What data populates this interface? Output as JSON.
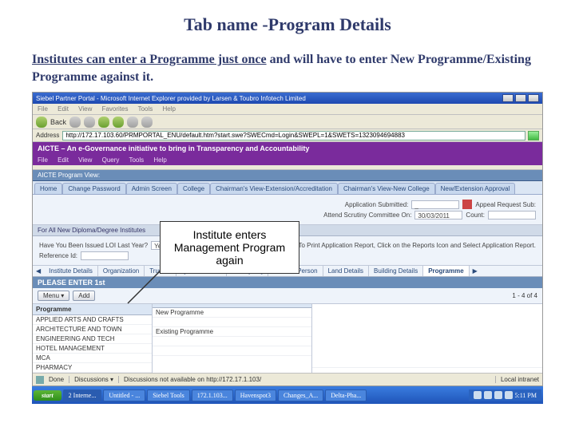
{
  "slide": {
    "title": "Tab name -Program Details",
    "sub_prefix_underlined": "Institutes can enter a Programme just once",
    "sub_suffix": " and will have to enter New Programme/Existing Programme against it."
  },
  "callout": "Institute enters Management Program again",
  "browser": {
    "title": "Siebel Partner Portal - Microsoft Internet Explorer provided by Larsen & Toubro Infotech Limited",
    "menu": [
      "File",
      "Edit",
      "View",
      "Favorites",
      "Tools",
      "Help"
    ],
    "back": "Back",
    "address_label": "Address",
    "url": "http://172.17.103.60/PRMPORTAL_ENU/default.htm?start.swe?SWECmd=Login&SWEPL=1&SWETS=1323094694883",
    "go": "Go"
  },
  "app": {
    "banner": "AICTE – An e-Governance initiative to bring in Transparency and Accountability",
    "menu": [
      "File",
      "Edit",
      "View",
      "Query",
      "Tools",
      "Help"
    ],
    "view_title": "AICTE Program View:",
    "tabs": [
      "Home",
      "Change Password",
      "Admin Screen",
      "College",
      "Chairman's View-Extension/Accreditation",
      "Chairman's View-New College",
      "New/Extension Approval"
    ]
  },
  "header_fields": {
    "app_sub_label": "Application Submitted:",
    "app_sub_value": "_",
    "attend_label": "Attend Scrutiny Committee On:",
    "attend_value": "30/03/2011",
    "appeal_label": "Appeal Request Sub:",
    "count_label": "Count:",
    "rule_title": "For All New Diploma/Degree Institutes",
    "loi_label": "Have You Been Issued LOI Last Year?",
    "loi_value": "Yes",
    "ref_label": "Reference Id:",
    "print_hint": "To Print Application Report, Click on the Reports Icon and Select Application Report."
  },
  "subtabs": [
    "Institute Details",
    "Organization",
    "Trustee",
    "Questionnaire",
    "Activity HQ",
    "Contact Person",
    "Land Details",
    "Building Details",
    "Programme"
  ],
  "please_bar": "PLEASE ENTER 1st",
  "list": {
    "menu_label": "Menu ▾",
    "add_btn": "Add",
    "pager": "1 - 4 of 4",
    "col1_header": "Programme",
    "col2_header": "",
    "col1_rows": [
      "APPLIED ARTS AND CRAFTS",
      "ARCHITECTURE AND TOWN",
      "ENGINEERING AND TECH",
      "HOTEL MANAGEMENT",
      "MCA",
      "PHARMACY"
    ],
    "col2_rows": [
      "New Programme",
      "",
      "Existing Programme",
      "",
      ""
    ]
  },
  "status": {
    "done": "Done",
    "discussions": "Discussions ▾",
    "not_avail": "Discussions not available on http://172.17.1.103/",
    "intranet": "Local intranet"
  },
  "taskbar": {
    "start": "start",
    "items": [
      "2 Interne...",
      "Untitled - ...",
      "Siebel Tools",
      "172.1.103...",
      "Havenspot3",
      "Changes_A...",
      "Delta-Pha..."
    ],
    "time": "5:11 PM"
  }
}
